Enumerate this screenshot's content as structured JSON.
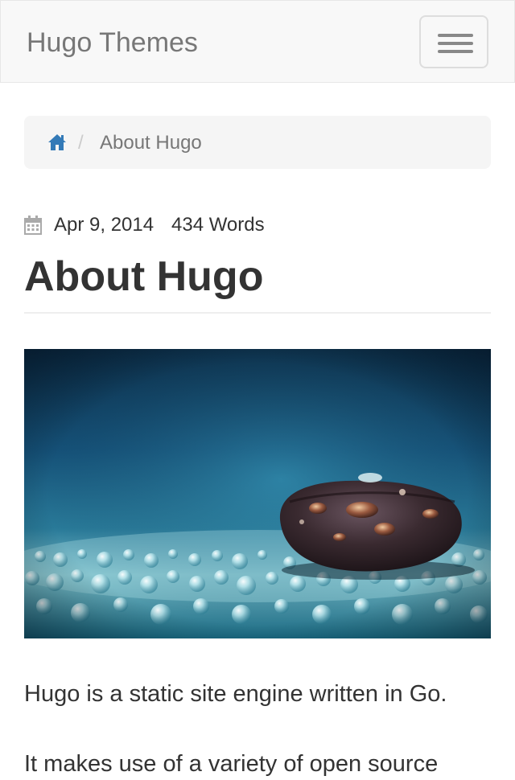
{
  "navbar": {
    "brand": "Hugo Themes",
    "toggle_icon": "hamburger-menu-icon"
  },
  "breadcrumb": {
    "home_icon": "home-icon",
    "home_color": "#337ab7",
    "separator": "/",
    "current": "About Hugo"
  },
  "post": {
    "meta_icon": "calendar-icon",
    "date": "Apr 9, 2014",
    "word_count": "434 Words",
    "title": "About Hugo",
    "image": {
      "subject": "coffee bean with water droplets on a blue background"
    },
    "paragraphs": [
      "Hugo is a static site engine written in Go.",
      "It makes use of a variety of open source"
    ]
  },
  "colors": {
    "navbar_bg": "#f8f8f8",
    "breadcrumb_bg": "#f5f5f5",
    "link": "#337ab7",
    "text": "#333333",
    "muted": "#777777"
  }
}
